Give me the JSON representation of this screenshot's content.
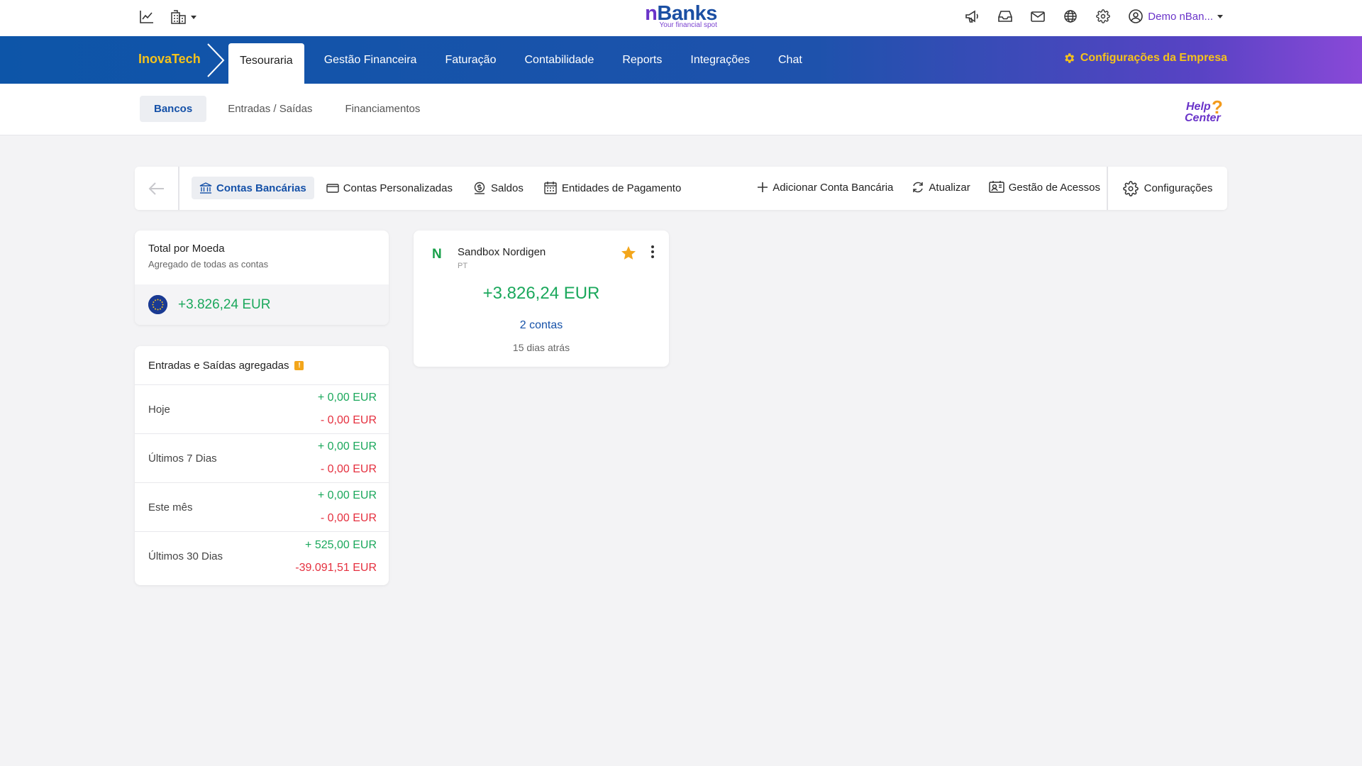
{
  "header": {
    "logo_main": "Banks",
    "logo_accent": "n",
    "logo_tagline": "Your financial spot",
    "user_label": "Demo nBan...",
    "icons": [
      "chart-line-icon",
      "building-icon",
      "megaphone-icon",
      "inbox-icon",
      "mail-icon",
      "globe-icon",
      "gear-icon",
      "user-circle-icon"
    ]
  },
  "main_nav": {
    "company": "InovaTech",
    "items": [
      {
        "label": "Tesouraria",
        "active": true
      },
      {
        "label": "Gestão Financeira"
      },
      {
        "label": "Faturação"
      },
      {
        "label": "Contabilidade"
      },
      {
        "label": "Reports"
      },
      {
        "label": "Integrações"
      },
      {
        "label": "Chat"
      }
    ],
    "company_settings": "Configurações da Empresa"
  },
  "sub_nav": {
    "items": [
      {
        "label": "Bancos",
        "active": true
      },
      {
        "label": "Entradas / Saídas"
      },
      {
        "label": "Financiamentos"
      }
    ],
    "help_top": "Help",
    "help_bottom": "Center",
    "help_mark": "?"
  },
  "toolbar": {
    "contas_bancarias": "Contas Bancárias",
    "contas_personalizadas": "Contas Personalizadas",
    "saldos": "Saldos",
    "entidades": "Entidades de Pagamento",
    "adicionar": "Adicionar Conta Bancária",
    "atualizar": "Atualizar",
    "gestao_acessos": "Gestão de Acessos",
    "configuracoes": "Configurações"
  },
  "total_card": {
    "title": "Total por Moeda",
    "subtitle": "Agregado de todas as contas",
    "value": "+3.826,24 EUR"
  },
  "flows_card": {
    "title": "Entradas e Saídas agregadas",
    "info_mark": "!",
    "rows": [
      {
        "label": "Hoje",
        "in": "+ 0,00 EUR",
        "out": "- 0,00 EUR"
      },
      {
        "label": "Últimos 7 Dias",
        "in": "+ 0,00 EUR",
        "out": "- 0,00 EUR"
      },
      {
        "label": "Este mês",
        "in": "+ 0,00 EUR",
        "out": "- 0,00 EUR"
      },
      {
        "label": "Últimos 30 Dias",
        "in": "+ 525,00 EUR",
        "out": "-39.091,51 EUR"
      }
    ]
  },
  "bank_card": {
    "logo_letter": "N",
    "name": "Sandbox Nordigen",
    "country": "PT",
    "balance": "+3.826,24 EUR",
    "accounts": "2 contas",
    "updated": "15 dias atrás"
  },
  "colors": {
    "primary": "#1551a8",
    "positive": "#1ba85c",
    "negative": "#e5303f",
    "accent_yellow": "#f5c21b",
    "star": "#f3a61b",
    "purple": "#6a34c9"
  }
}
